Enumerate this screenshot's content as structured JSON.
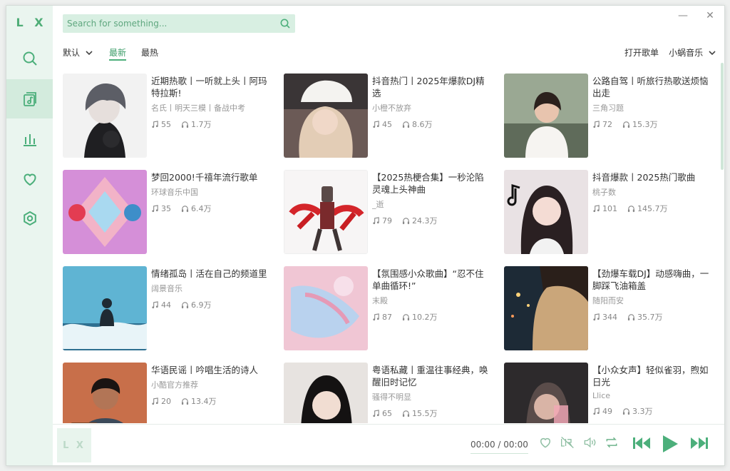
{
  "app": {
    "logo": "L X"
  },
  "search": {
    "placeholder": "Search for something..."
  },
  "filter": {
    "sort": "默认",
    "latest": "最新",
    "hot": "最热",
    "open": "打开歌单",
    "source": "小蜗音乐"
  },
  "cards": [
    {
      "title": "近期热歌丨一听就上头丨阿玛特拉斯!",
      "author": "名氏丨明天三模丨备战中考",
      "songs": "55",
      "plays": "1.7万"
    },
    {
      "title": "抖音热门丨2025年爆款DJ精选",
      "author": "小橙不放弃",
      "songs": "45",
      "plays": "8.6万"
    },
    {
      "title": "公路自驾丨听旅行热歌送烦恼出走",
      "author": "三角习题",
      "songs": "72",
      "plays": "15.3万"
    },
    {
      "title": "梦回2000!千禧年流行歌单",
      "author": "环球音乐中国",
      "songs": "35",
      "plays": "6.4万"
    },
    {
      "title": "【2025热梗合集】一秒沦陷灵魂上头神曲",
      "author": "_逝",
      "songs": "79",
      "plays": "24.3万"
    },
    {
      "title": "抖音爆款丨2025热门歌曲",
      "author": "桃子数",
      "songs": "101",
      "plays": "145.7万"
    },
    {
      "title": "情绪孤岛丨活在自己的频道里",
      "author": "阔景音乐",
      "songs": "44",
      "plays": "6.9万"
    },
    {
      "title": "【氛围感小众歌曲】“忍不住单曲循环!”",
      "author": "末殿",
      "songs": "87",
      "plays": "10.2万"
    },
    {
      "title": "【劲爆车载DJ】动感嗨曲，一脚踩飞油箱盖",
      "author": "随阳而安",
      "songs": "344",
      "plays": "35.7万"
    },
    {
      "title": "华语民谣丨吟唱生活的诗人",
      "author": "小酷官方推荐",
      "songs": "20",
      "plays": "13.4万"
    },
    {
      "title": "粤语私藏丨重温往事经典，唤醒旧时记忆",
      "author": "骚得不明显",
      "songs": "65",
      "plays": "15.5万"
    },
    {
      "title": "【小众女声】轻似雀羽，煦如日光",
      "author": "Llice",
      "songs": "49",
      "plays": "3.3万"
    }
  ],
  "player": {
    "cover_text": "L X",
    "time": "00:00 / 00:00"
  },
  "colors": {
    "accent": "#4caf7b",
    "sidebar": "#eaf5ef"
  }
}
